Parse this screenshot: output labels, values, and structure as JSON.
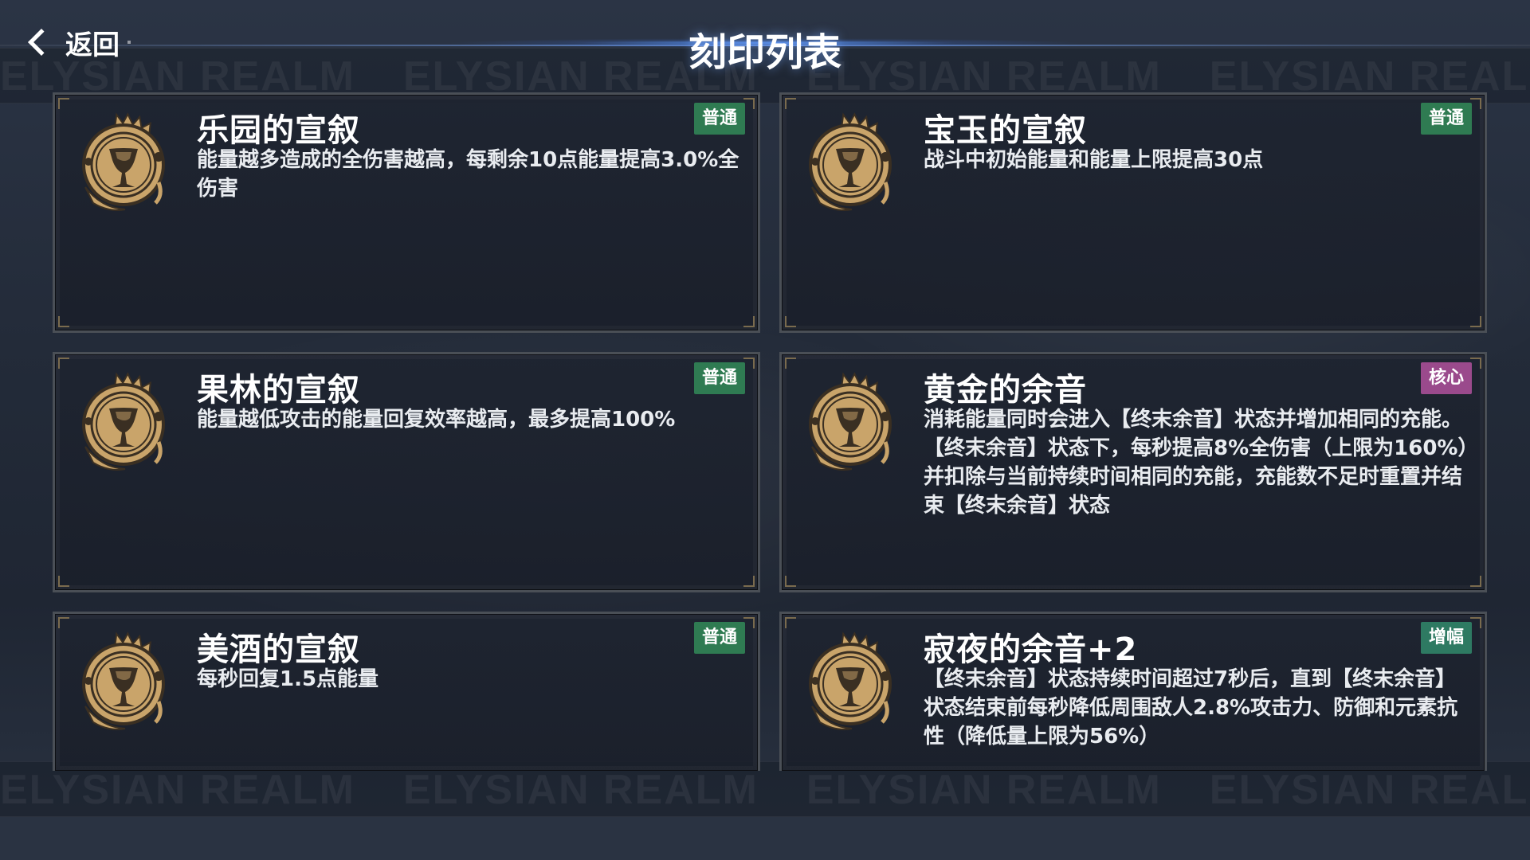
{
  "header": {
    "back_label": "返回",
    "title": "刻印列表"
  },
  "watermark_text": "ELYSIAN REALM",
  "colors": {
    "tag_normal": "#2f7b52",
    "tag_core": "#9a4a8c",
    "tag_boost": "#2e7a62",
    "emblem_gold": "#c9a46a",
    "emblem_dark": "#3a2f22"
  },
  "cards": [
    {
      "title": "乐园的宣叙",
      "tag": "普通",
      "tag_type": "normal",
      "icon": "grail-emblem-icon",
      "description": "能量越多造成的全伤害越高，每剩余10点能量提高3.0%全伤害"
    },
    {
      "title": "宝玉的宣叙",
      "tag": "普通",
      "tag_type": "normal",
      "icon": "grail-emblem-icon",
      "description": "战斗中初始能量和能量上限提高30点"
    },
    {
      "title": "果林的宣叙",
      "tag": "普通",
      "tag_type": "normal",
      "icon": "grail-emblem-icon",
      "description": "能量越低攻击的能量回复效率越高，最多提高100%"
    },
    {
      "title": "黄金的余音",
      "tag": "核心",
      "tag_type": "core",
      "icon": "grail-emblem-icon",
      "description": "消耗能量同时会进入【终末余音】状态并增加相同的充能。【终末余音】状态下，每秒提高8%全伤害（上限为160%）并扣除与当前持续时间相同的充能，充能数不足时重置并结束【终末余音】状态"
    },
    {
      "title": "美酒的宣叙",
      "tag": "普通",
      "tag_type": "normal",
      "icon": "grail-emblem-icon",
      "description": "每秒回复1.5点能量"
    },
    {
      "title": "寂夜的余音+2",
      "tag": "增幅",
      "tag_type": "boost",
      "icon": "grail-emblem-icon",
      "description": "【终末余音】状态持续时间超过7秒后，直到【终末余音】状态结束前每秒降低周围敌人2.8%攻击力、防御和元素抗性（降低量上限为56%）"
    }
  ]
}
